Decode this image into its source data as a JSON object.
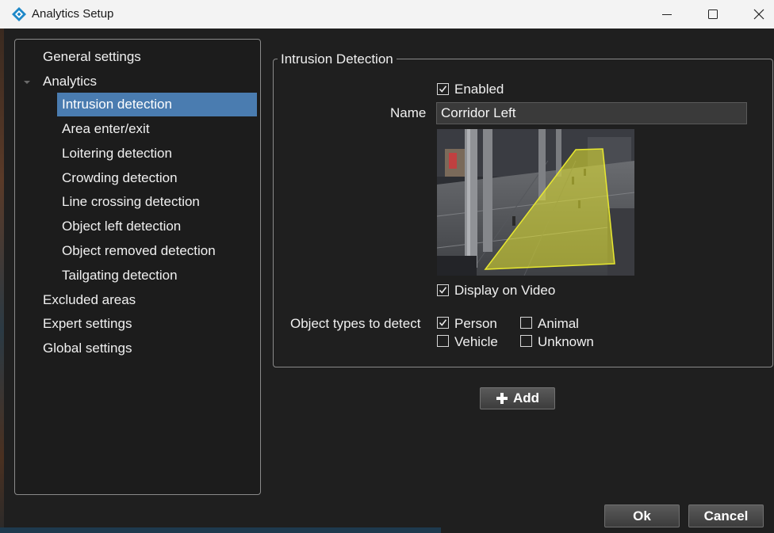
{
  "window": {
    "title": "Analytics Setup",
    "minimize_label": "Minimize",
    "maximize_label": "Maximize",
    "close_label": "Close"
  },
  "nav": {
    "items": [
      {
        "label": "General settings"
      },
      {
        "label": "Analytics"
      },
      {
        "label": "Intrusion detection"
      },
      {
        "label": "Area enter/exit"
      },
      {
        "label": "Loitering detection"
      },
      {
        "label": "Crowding detection"
      },
      {
        "label": "Line crossing detection"
      },
      {
        "label": "Object left detection"
      },
      {
        "label": "Object removed detection"
      },
      {
        "label": "Tailgating detection"
      },
      {
        "label": "Excluded areas"
      },
      {
        "label": "Expert settings"
      },
      {
        "label": "Global settings"
      }
    ],
    "selected": "Intrusion detection"
  },
  "detection": {
    "group_title": "Intrusion Detection",
    "enabled_label": "Enabled",
    "enabled": true,
    "name_label": "Name",
    "name_value": "Corridor Left",
    "display_on_video_label": "Display on Video",
    "display_on_video": true,
    "object_types_label": "Object types to detect",
    "object_types": [
      {
        "label": "Person",
        "checked": true
      },
      {
        "label": "Animal",
        "checked": false
      },
      {
        "label": "Vehicle",
        "checked": false
      },
      {
        "label": "Unknown",
        "checked": false
      }
    ],
    "zone_color": "#e8e830"
  },
  "buttons": {
    "add_label": "Add",
    "ok_label": "Ok",
    "cancel_label": "Cancel"
  },
  "colors": {
    "selection": "#4a7cb0",
    "background": "#1f1f1f",
    "app_icon": "#1e88c8"
  }
}
